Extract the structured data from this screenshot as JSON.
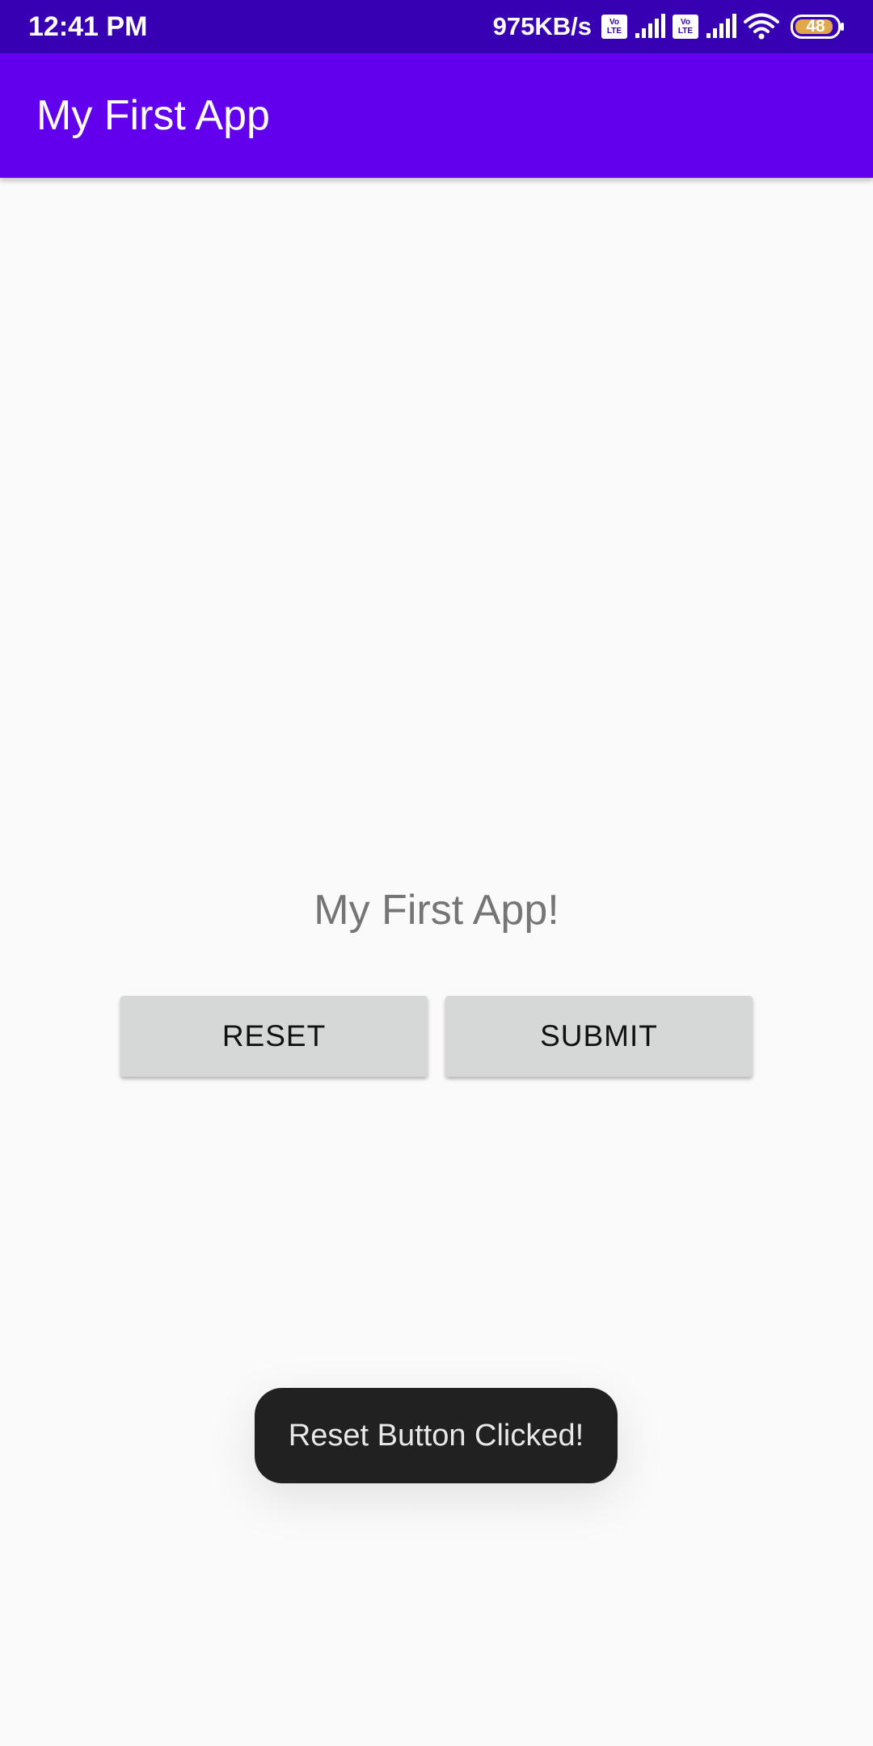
{
  "status_bar": {
    "time": "12:41 PM",
    "net_speed": "975KB/s",
    "volte_top": "Vo",
    "volte_bottom": "LTE",
    "battery": "48",
    "icons": [
      "volte-icon",
      "signal-icon",
      "volte-icon",
      "signal-icon",
      "wifi-icon",
      "battery-icon"
    ]
  },
  "app_bar": {
    "title": "My First App"
  },
  "main": {
    "text": "My First App!",
    "reset_label": "RESET",
    "submit_label": "SUBMIT"
  },
  "toast": {
    "message": "Reset Button Clicked!"
  },
  "colors": {
    "status_bar": "#3700b3",
    "app_bar": "#6200ee",
    "background": "#fafafa",
    "button": "#d6d7d7",
    "toast": "#212121",
    "body_text": "#757575"
  }
}
